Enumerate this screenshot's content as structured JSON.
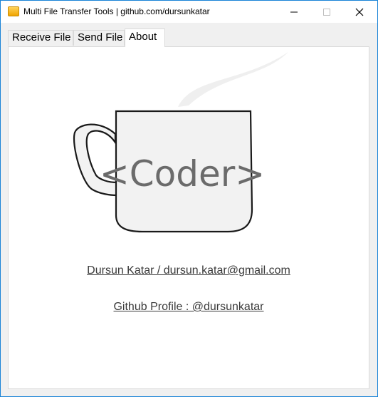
{
  "window": {
    "title": "Multi File Transfer Tools | github.com/dursunkatar"
  },
  "tabs": [
    {
      "label": "Receive File",
      "active": false
    },
    {
      "label": "Send File",
      "active": false
    },
    {
      "label": "About",
      "active": true
    }
  ],
  "about": {
    "logo_text": "<Coder>",
    "author_line": "Dursun Katar / dursun.katar@gmail.com",
    "github_line": "Github Profile : @dursunkatar"
  },
  "colors": {
    "window_border": "#1883d7",
    "link_text": "#3a3a3a",
    "mug_fill": "#f2f2f2",
    "logo_text": "#6b6b6b"
  },
  "icons": [
    "app-icon",
    "minimize-icon",
    "maximize-icon",
    "close-icon",
    "coffee-mug-logo"
  ]
}
